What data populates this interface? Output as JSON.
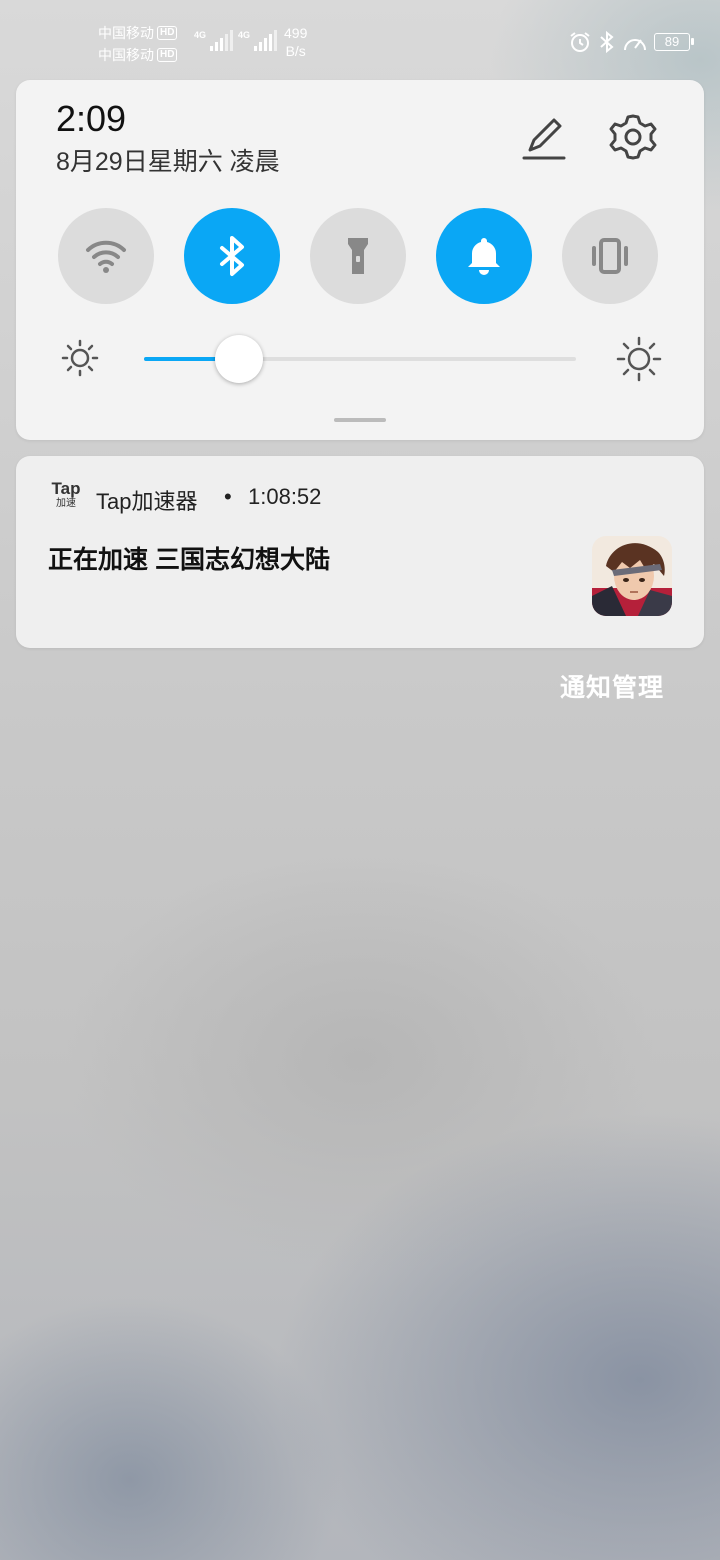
{
  "status_bar": {
    "carrier_1": "中国移动",
    "carrier_2": "中国移动",
    "hd_label": "HD",
    "net_1": "4G",
    "net_2": "4G",
    "speed_value": "499",
    "speed_unit": "B/s",
    "battery": "89"
  },
  "quick_panel": {
    "time": "2:09",
    "date": "8月29日星期六 凌晨",
    "toggles": [
      {
        "name": "wifi",
        "on": false
      },
      {
        "name": "bluetooth",
        "on": true
      },
      {
        "name": "flashlight",
        "on": false
      },
      {
        "name": "sound",
        "on": true
      },
      {
        "name": "vibrate",
        "on": false
      }
    ],
    "brightness_level": 0.22
  },
  "notification": {
    "app_icon_text_top": "Tap",
    "app_icon_text_bottom": "加速",
    "app_name": "Tap加速器",
    "separator": "•",
    "time": "1:08:52",
    "title": "正在加速 三国志幻想大陆"
  },
  "manage_label": "通知管理",
  "colors": {
    "accent": "#0aa7f5",
    "tile_off": "#dcdcdc",
    "panel_bg": "#f3f3f3"
  }
}
